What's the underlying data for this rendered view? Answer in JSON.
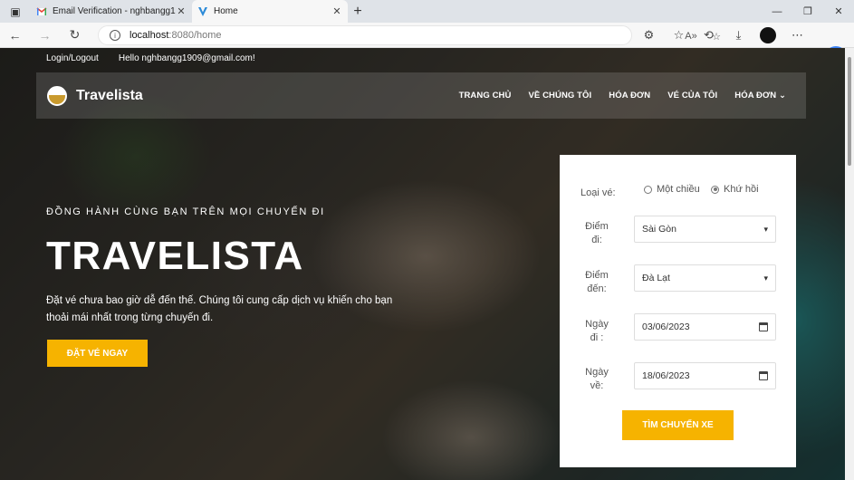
{
  "browser": {
    "tabs": [
      {
        "title": "Email Verification - nghbangg190",
        "icon": "gmail-icon"
      },
      {
        "title": "Home",
        "icon": "vite-icon"
      }
    ],
    "url_host": "localhost",
    "url_path": ":8080/home"
  },
  "topbar": {
    "login_logout": "Login/Logout",
    "greeting": "Hello nghbangg1909@gmail.com!"
  },
  "navbar": {
    "brand": "Travelista",
    "menu": [
      "TRANG CHỦ",
      "VỀ CHÚNG TÔI",
      "HÓA ĐƠN",
      "VÉ CỦA TÔI",
      "HÓA ĐƠN"
    ]
  },
  "hero": {
    "eyebrow": "ĐỒNG HÀNH CÙNG BẠN TRÊN MỌI CHUYẾN ĐI",
    "title": "TRAVELISTA",
    "description": "Đặt vé chưa bao giờ dễ đến thế. Chúng tôi cung cấp dịch vụ khiến cho bạn thoải mái nhất trong từng chuyến đi.",
    "cta": "ĐẶT VÉ NGAY"
  },
  "booking": {
    "ticket_type_label": "Loại vé:",
    "one_way": "Một chiều",
    "round_trip": "Khứ hồi",
    "selected_type": "round_trip",
    "from_label": "Điểm đi:",
    "from_value": "Sài Gòn",
    "to_label": "Điểm đến:",
    "to_value": "Đà Lạt",
    "depart_label": "Ngày đi :",
    "depart_value": "03/06/2023",
    "return_label": "Ngày về:",
    "return_value": "18/06/2023",
    "submit": "TÌM CHUYẾN XE"
  },
  "colors": {
    "accent": "#f6b300"
  }
}
